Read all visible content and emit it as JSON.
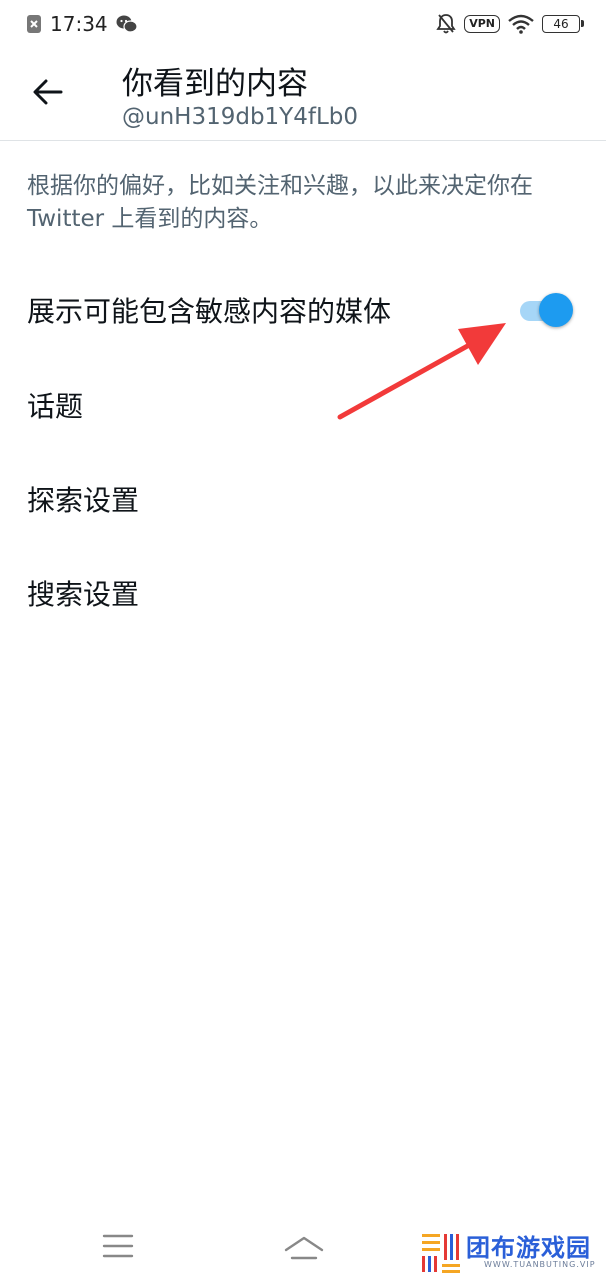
{
  "status_bar": {
    "time": "17:34",
    "vpn": "VPN",
    "battery": "46"
  },
  "header": {
    "title": "你看到的内容",
    "handle": "@unH319db1Y4fLb0"
  },
  "description": "根据你的偏好，比如关注和兴趣，以此来决定你在 Twitter 上看到的内容。",
  "settings": [
    {
      "label": "展示可能包含敏感内容的媒体",
      "toggle": true
    },
    {
      "label": "话题"
    },
    {
      "label": "探索设置"
    },
    {
      "label": "搜索设置"
    }
  ],
  "colors": {
    "accent": "#1d9bf0",
    "toggle_track": "#a6d6f7",
    "annotation_arrow": "#f23a3a"
  },
  "watermark": {
    "name": "团布游戏园",
    "url": "WWW.TUANBUTING.VIP"
  }
}
